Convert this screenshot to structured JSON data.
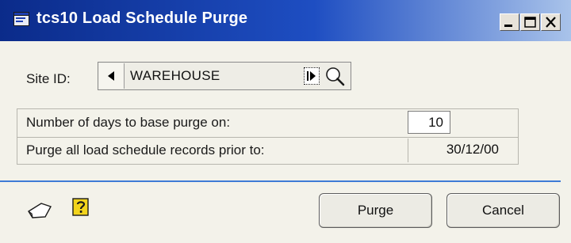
{
  "window": {
    "title": "tcs10 Load Schedule Purge"
  },
  "site": {
    "label": "Site ID:",
    "value": "WAREHOUSE"
  },
  "purge_settings": {
    "days_label": "Number of days to base purge on:",
    "days_value": "10",
    "prior_label": "Purge all load schedule records prior to:",
    "prior_date": "30/12/00"
  },
  "buttons": {
    "purge": "Purge",
    "cancel": "Cancel"
  },
  "colors": {
    "title_bar_start": "#0b2b8a",
    "title_bar_end": "#a9c3ea",
    "separator": "#3e7bd6",
    "help_icon_fill": "#f2d41c"
  },
  "icons": [
    "window-app-icon",
    "minimize-icon",
    "maximize-icon",
    "close-icon",
    "browse-previous-icon",
    "browse-next-icon",
    "lookup-search-icon",
    "note-icon",
    "help-icon"
  ]
}
